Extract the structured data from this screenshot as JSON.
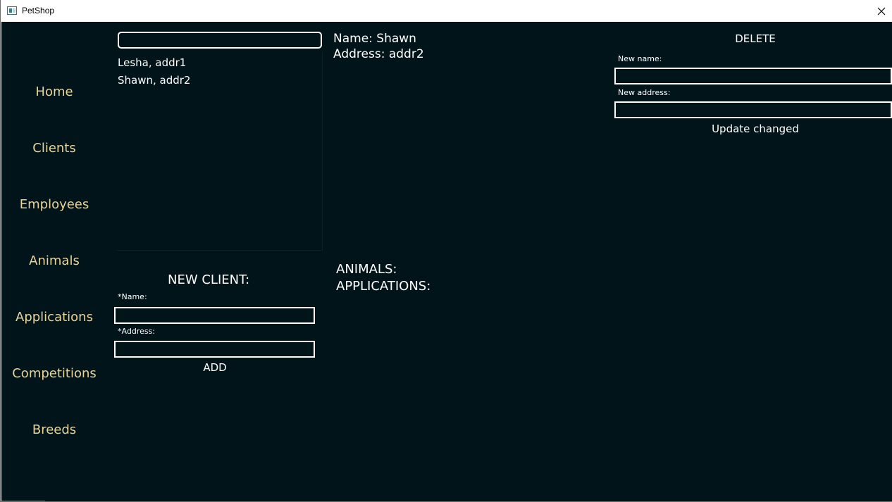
{
  "window": {
    "title": "PetShop"
  },
  "nav": {
    "items": [
      {
        "label": "Home"
      },
      {
        "label": "Clients"
      },
      {
        "label": "Employees"
      },
      {
        "label": "Animals"
      },
      {
        "label": "Applications"
      },
      {
        "label": "Competitions"
      },
      {
        "label": "Breeds"
      }
    ]
  },
  "search": {
    "value": "",
    "placeholder": ""
  },
  "clients": [
    {
      "label": "Lesha, addr1"
    },
    {
      "label": "Shawn, addr2"
    }
  ],
  "details": {
    "name_line": "Name: Shawn",
    "address_line": "Address: addr2",
    "animals_label": "ANIMALS:",
    "applications_label": "APPLICATIONS:"
  },
  "edit": {
    "delete_label": "DELETE",
    "new_name_label": "New name:",
    "new_name_value": "",
    "new_address_label": "New address:",
    "new_address_value": "",
    "update_label": "Update changed"
  },
  "new_client": {
    "title": "NEW CLIENT:",
    "name_label": "*Name:",
    "name_value": "",
    "address_label": "*Address:",
    "address_value": "",
    "add_label": "ADD"
  },
  "colors": {
    "background": "#01141a",
    "nav_text": "#e8d49a",
    "text": "#ffffff"
  }
}
